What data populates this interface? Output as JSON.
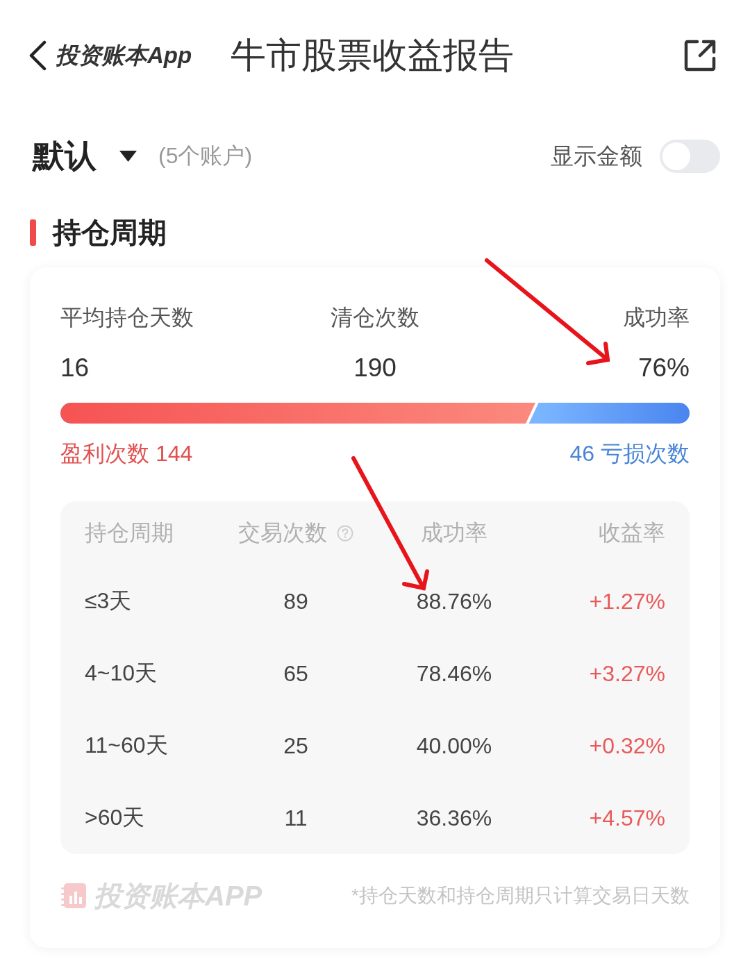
{
  "header": {
    "back_label": "投资账本App",
    "title": "牛市股票收益报告"
  },
  "account": {
    "name": "默认",
    "count": "(5个账户)",
    "show_amount_label": "显示金额",
    "show_amount": false
  },
  "section": {
    "title": "持仓周期"
  },
  "summary": {
    "stats": [
      {
        "label": "平均持仓天数",
        "value": "16"
      },
      {
        "label": "清仓次数",
        "value": "190"
      },
      {
        "label": "成功率",
        "value": "76%"
      }
    ],
    "ratio": {
      "level": 0.76,
      "profit_label": "盈利次数 144",
      "loss_label": "46 亏损次数"
    }
  },
  "table": {
    "columns": [
      {
        "label": "持仓周期",
        "help": false
      },
      {
        "label": "交易次数",
        "help": true
      },
      {
        "label": "成功率",
        "help": false
      },
      {
        "label": "收益率",
        "help": false
      }
    ],
    "rows": [
      {
        "period": "≤3天",
        "trades": "89",
        "success_rate": "88.76%",
        "return": "+1.27%"
      },
      {
        "period": "4~10天",
        "trades": "65",
        "success_rate": "78.46%",
        "return": "+3.27%"
      },
      {
        "period": "11~60天",
        "trades": "25",
        "success_rate": "40.00%",
        "return": "+0.32%"
      },
      {
        "period": ">60天",
        "trades": "11",
        "success_rate": "36.36%",
        "return": "+4.57%"
      }
    ]
  },
  "footer": {
    "brand": "投资账本APP",
    "note": "*持仓天数和持仓周期只计算交易日天数"
  }
}
